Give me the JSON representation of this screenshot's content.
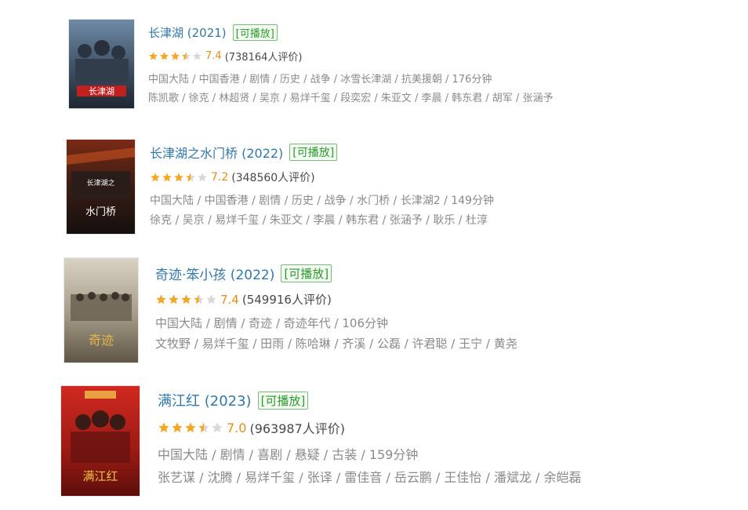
{
  "theme": {
    "link": "#3377aa",
    "playable": "#2c9b2c",
    "star_on": "#f5a623",
    "star_off": "#d8d8d8",
    "meta": "#8a8a8a"
  },
  "movies": [
    {
      "title": "长津湖 (2021)",
      "playable": "[可播放]",
      "stars": 3.5,
      "score": "7.4",
      "votes": "(738164人评价)",
      "meta": "中国大陆 / 中国香港 / 剧情 / 历史 / 战争 / 冰雪长津湖 / 抗美援朝 / 176分钟",
      "cast": "陈凯歌 / 徐克 / 林超贤 / 吴京 / 易烊千玺 / 段奕宏 / 朱亚文 / 李晨 / 韩东君 / 胡军 / 张涵予",
      "poster_text": "长津湖",
      "poster_icon": "film-poster-icon"
    },
    {
      "title": "长津湖之水门桥 (2022)",
      "playable": "[可播放]",
      "stars": 3.5,
      "score": "7.2",
      "votes": "(348560人评价)",
      "meta": "中国大陆 / 中国香港 / 剧情 / 历史 / 战争 / 水门桥 / 长津湖2 / 149分钟",
      "cast": "徐克 / 吴京 / 易烊千玺 / 朱亚文 / 李晨 / 韩东君 / 张涵予 / 耿乐 / 杜淳",
      "poster_text": "水门桥",
      "poster_icon": "film-poster-icon"
    },
    {
      "title": "奇迹·笨小孩 (2022)",
      "playable": "[可播放]",
      "stars": 3.5,
      "score": "7.4",
      "votes": "(549916人评价)",
      "meta": "中国大陆 / 剧情 / 奇迹 / 奇迹年代 / 106分钟",
      "cast": "文牧野 / 易烊千玺 / 田雨 / 陈哈琳 / 齐溪 / 公磊 / 许君聪 / 王宁 / 黄尧",
      "poster_text": "奇迹",
      "poster_icon": "film-poster-icon"
    },
    {
      "title": "满江红 (2023)",
      "playable": "[可播放]",
      "stars": 3.5,
      "score": "7.0",
      "votes": "(963987人评价)",
      "meta": "中国大陆 / 剧情 / 喜剧 / 悬疑 / 古装 / 159分钟",
      "cast": "张艺谋 / 沈腾 / 易烊千玺 / 张译 / 雷佳音 / 岳云鹏 / 王佳怡 / 潘斌龙 / 余皑磊",
      "poster_text": "满江红",
      "poster_icon": "film-poster-icon"
    }
  ]
}
